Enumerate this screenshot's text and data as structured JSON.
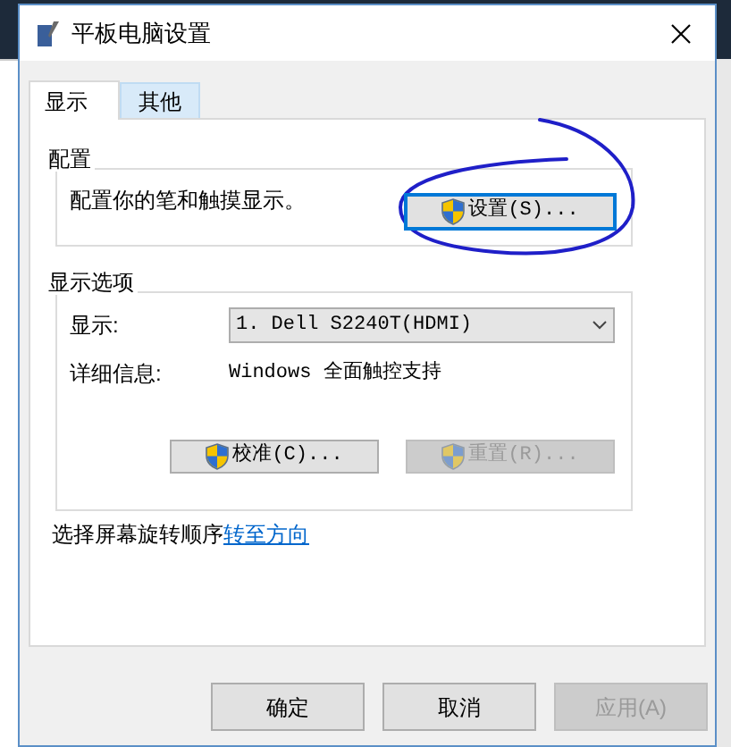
{
  "window": {
    "title": "平板电脑设置"
  },
  "tabs": [
    {
      "label": "显示",
      "selected": true
    },
    {
      "label": "其他",
      "selected": false
    }
  ],
  "config_group": {
    "title": "配置",
    "description": "配置你的笔和触摸显示。",
    "button": {
      "label": "设置(S)...",
      "default": true
    }
  },
  "display_group": {
    "title": "显示选项",
    "display_label": "显示:",
    "display_value": "1. Dell S2240T(HDMI)",
    "details_label": "详细信息:",
    "details_value": "Windows 全面触控支持",
    "buttons": [
      {
        "label": "校准(C)...",
        "disabled": false
      },
      {
        "label": "重置(R)...",
        "disabled": true
      }
    ]
  },
  "rotation": {
    "text": "选择屏幕旋转顺序",
    "link": "转至方向"
  },
  "footer_buttons": [
    {
      "label": "确定",
      "disabled": false
    },
    {
      "label": "取消",
      "disabled": false
    },
    {
      "label": "应用(A)",
      "disabled": true
    }
  ]
}
